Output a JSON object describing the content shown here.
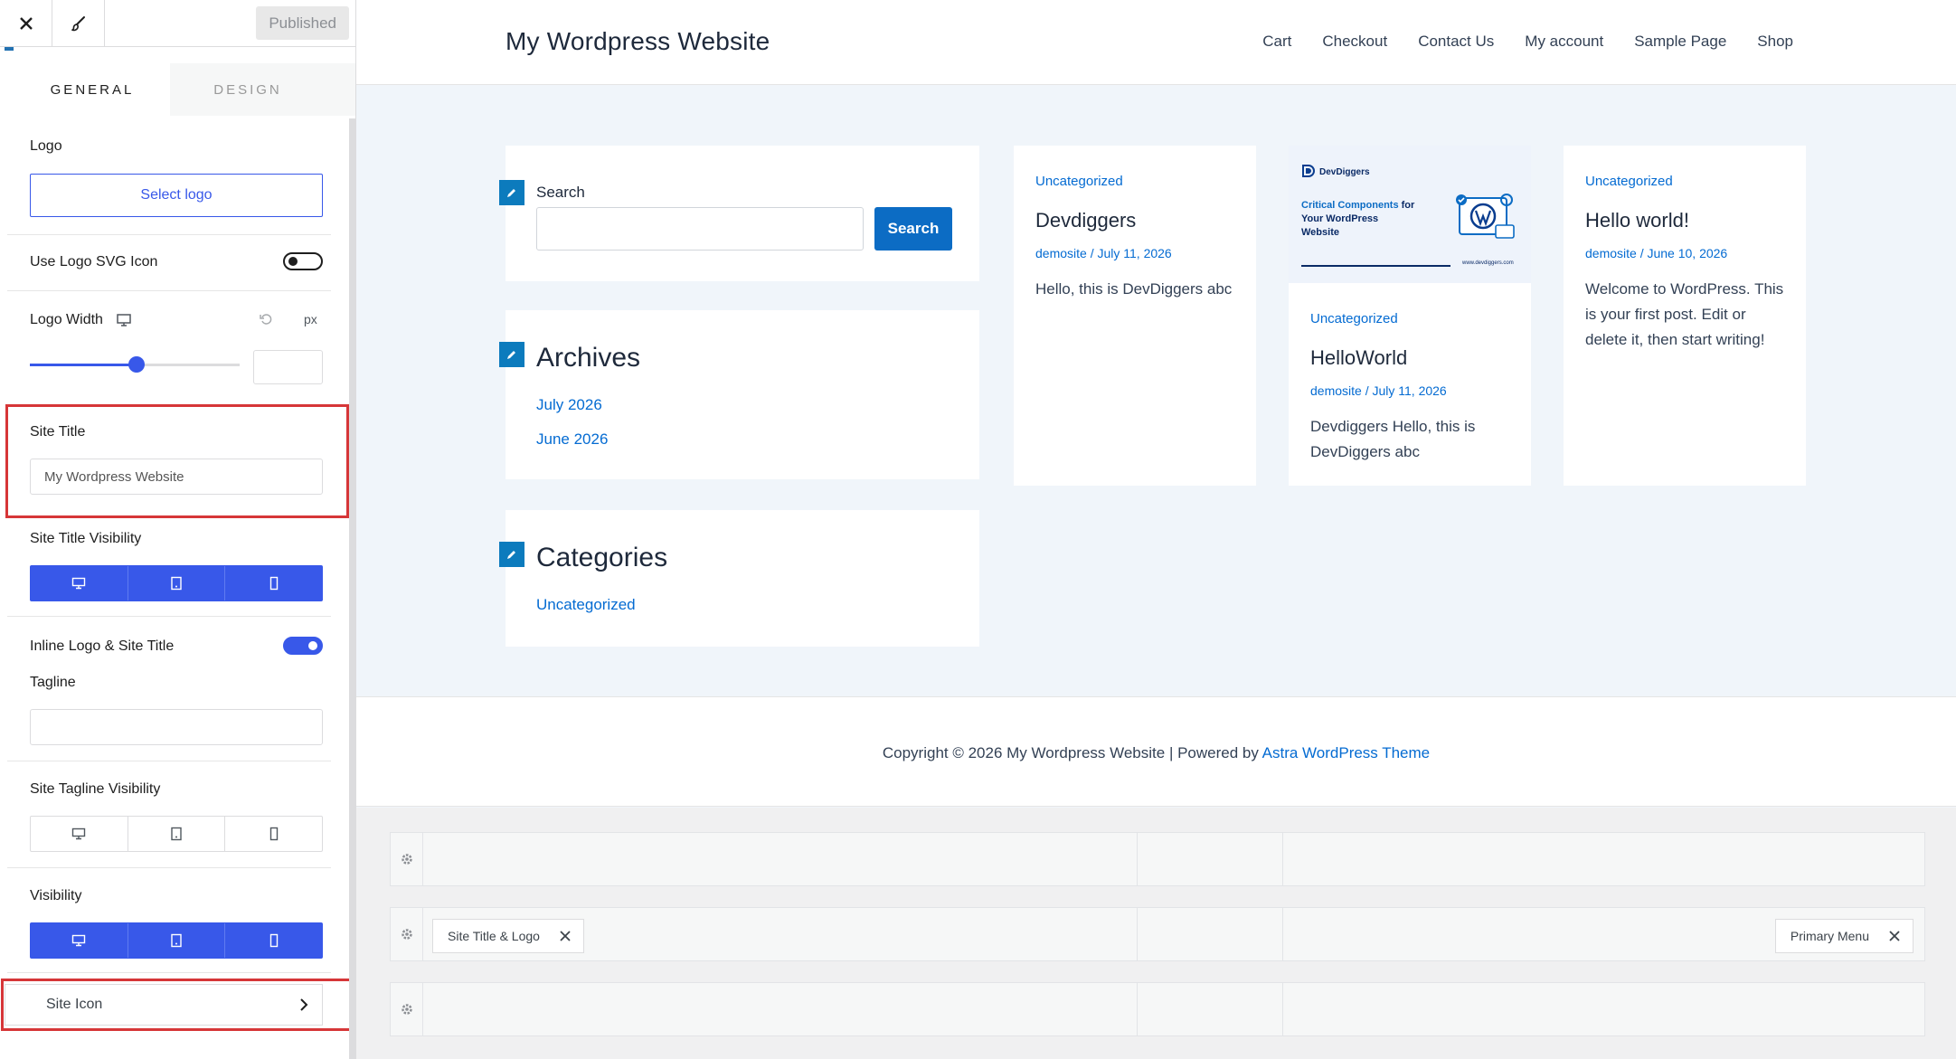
{
  "sidebar": {
    "published_label": "Published",
    "tabs": [
      "General",
      "Design"
    ],
    "logo_label": "Logo",
    "select_logo_label": "Select logo",
    "use_logo_svg_label": "Use Logo SVG Icon",
    "logo_width_label": "Logo Width",
    "logo_width_unit": "px",
    "logo_width_slider": 0.51,
    "site_title_label": "Site Title",
    "site_title_value": "My Wordpress Website",
    "site_title_visibility_label": "Site Title Visibility",
    "inline_logo_label": "Inline Logo & Site Title",
    "tagline_label": "Tagline",
    "tagline_value": "",
    "site_tagline_visibility_label": "Site Tagline Visibility",
    "visibility_label": "Visibility",
    "site_icon_label": "Site Icon"
  },
  "site": {
    "title": "My Wordpress Website",
    "nav": [
      "Cart",
      "Checkout",
      "Contact Us",
      "My account",
      "Sample Page",
      "Shop"
    ],
    "search": {
      "label": "Search",
      "button": "Search"
    },
    "archives": {
      "title": "Archives",
      "items": [
        "July 2026",
        "June 2026"
      ]
    },
    "categories": {
      "title": "Categories",
      "items": [
        "Uncategorized"
      ]
    },
    "posts": [
      {
        "category": "Uncategorized",
        "title": "Devdiggers",
        "meta": "demosite / July 11, 2026",
        "excerpt": "Hello, this is DevDiggers abc"
      },
      {
        "category": "Uncategorized",
        "title": "HelloWorld",
        "meta": "demosite / July 11, 2026",
        "excerpt": "Devdiggers Hello, this is DevDiggers abc"
      },
      {
        "category": "Uncategorized",
        "title": "Hello world!",
        "meta": "demosite / June 10, 2026",
        "excerpt": "Welcome to WordPress. This is your first post. Edit or delete it, then start writing!"
      }
    ],
    "thumb": {
      "brand": "DevDiggers",
      "line1": "Critical Components",
      "line1b": " for",
      "line2": "Your WordPress",
      "line3": "Website",
      "url": "www.devdiggers.com"
    },
    "footer": {
      "prefix": "Copyright © 2026 My Wordpress Website | Powered by ",
      "link": "Astra WordPress Theme"
    }
  },
  "builder": {
    "chip_left": "Site Title & Logo",
    "chip_right": "Primary Menu"
  },
  "colors": {
    "accent": "#3858e9",
    "link": "#046bd2",
    "highlight": "#d63638"
  }
}
